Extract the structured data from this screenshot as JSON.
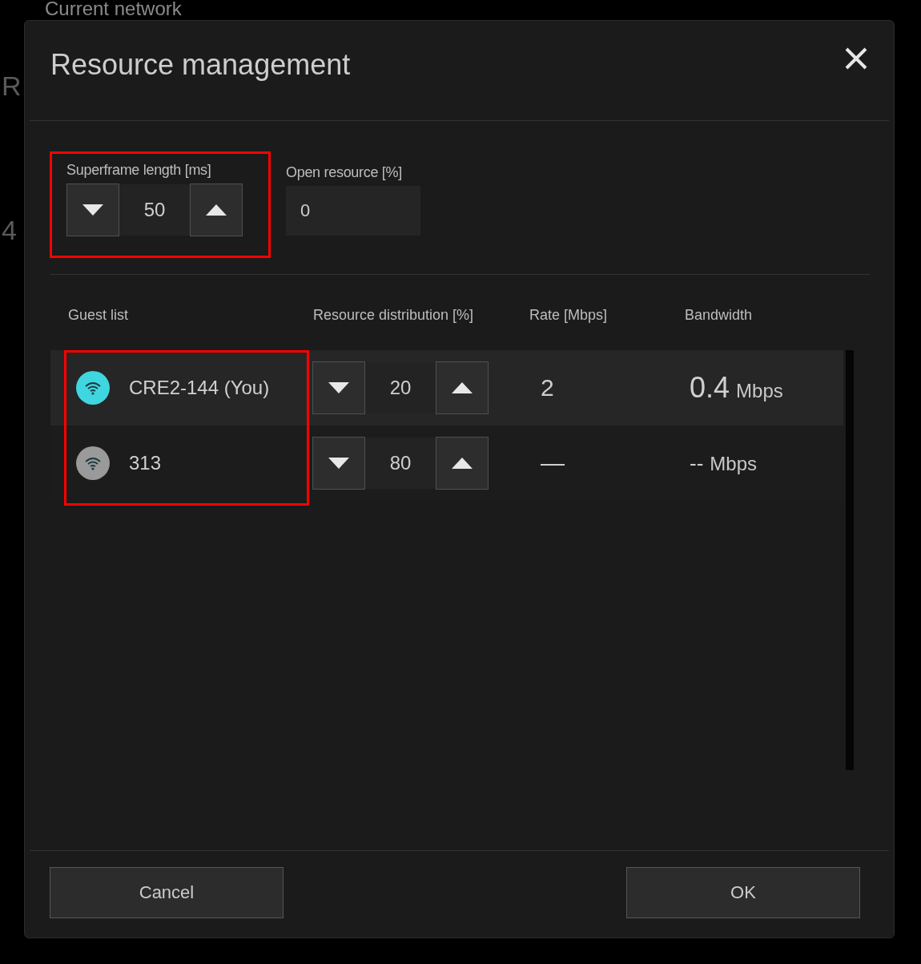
{
  "background": {
    "title": "Current network",
    "edge_letters": [
      "R",
      "4"
    ]
  },
  "dialog": {
    "title": "Resource management",
    "superframe": {
      "label": "Superframe length [ms]",
      "value": "50",
      "highlighted": true
    },
    "open_resource": {
      "label": "Open resource [%]",
      "value": "0"
    },
    "table": {
      "columns": [
        "Guest list",
        "Resource distribution [%]",
        "Rate [Mbps]",
        "Bandwidth"
      ],
      "guests_highlighted": true,
      "rows": [
        {
          "name": "CRE2-144 (You)",
          "color": "#3fd6e0",
          "selected": true,
          "distribution": "20",
          "rate": "2",
          "bandwidth": "0.4",
          "unit": "Mbps"
        },
        {
          "name": "313",
          "color": "#9a9a9a",
          "selected": false,
          "distribution": "80",
          "rate": "—",
          "bandwidth": "--",
          "unit": "Mbps"
        }
      ]
    },
    "buttons": [
      "Cancel",
      "OK"
    ]
  }
}
